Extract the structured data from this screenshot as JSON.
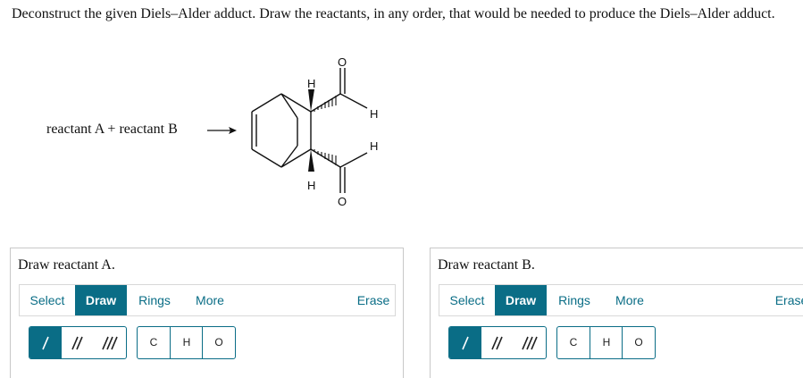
{
  "question": {
    "text": "Deconstruct the given Diels–Alder adduct. Draw the reactants, in any order, that would be needed to produce the Diels–Alder adduct."
  },
  "equation": {
    "text": "reactant A + reactant B"
  },
  "structure": {
    "atom_labels": {
      "h_top": "H",
      "h_bottom": "H",
      "h_ald_top": "H",
      "h_ald_bottom": "H",
      "o_top": "O",
      "o_bottom": "O"
    }
  },
  "panels": [
    {
      "title": "Draw reactant A.",
      "toolbar": {
        "select": "Select",
        "draw": "Draw",
        "rings": "Rings",
        "more": "More",
        "erase": "Erase"
      },
      "atoms": {
        "c": "C",
        "h": "H",
        "o": "O"
      }
    },
    {
      "title": "Draw reactant B.",
      "toolbar": {
        "select": "Select",
        "draw": "Draw",
        "rings": "Rings",
        "more": "More",
        "erase": "Erase"
      },
      "atoms": {
        "c": "C",
        "h": "H",
        "o": "O"
      }
    }
  ],
  "colors": {
    "accent": "#0a6d86",
    "border": "#c8c8c8"
  },
  "icons": {
    "single_bond": "single-bond-icon",
    "double_bond": "double-bond-icon",
    "triple_bond": "triple-bond-icon",
    "arrow": "reaction-arrow-icon"
  }
}
